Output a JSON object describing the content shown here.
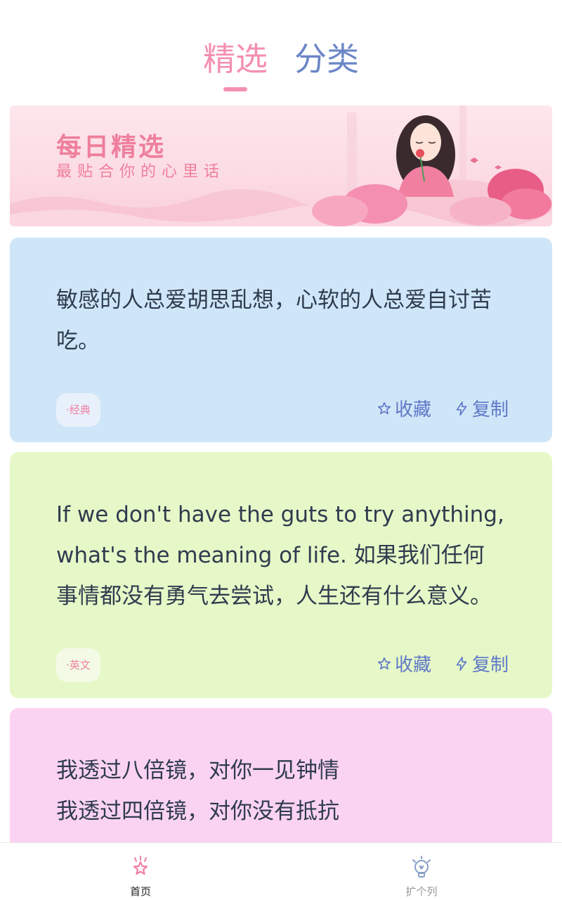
{
  "tabs": [
    {
      "label": "精选",
      "active": true
    },
    {
      "label": "分类",
      "active": false
    }
  ],
  "banner": {
    "title": "每日精选",
    "subtitle": "最贴合你的心里话"
  },
  "cards": [
    {
      "text": "敏感的人总爱胡思乱想，心软的人总爱自讨苦吃。",
      "tag": "·经典",
      "background": "#cfe6f8",
      "favorite_label": "收藏",
      "copy_label": "复制"
    },
    {
      "text": "If we don't have the guts to try anything, what's the meaning of life. 如果我们任何事情都没有勇气去尝试，人生还有什么意义。",
      "tag": "·英文",
      "background": "#e6f8c7",
      "favorite_label": "收藏",
      "copy_label": "复制"
    },
    {
      "text_lines": [
        "我透过八倍镜，对你一见钟情",
        "我透过四倍镜，对你没有抵抗"
      ],
      "background": "#fbd3f2"
    }
  ],
  "bottom_nav": [
    {
      "label": "首页",
      "icon": "star-home-icon",
      "active": true
    },
    {
      "label": "扩个列",
      "icon": "lightbulb-icon",
      "active": false
    }
  ],
  "colors": {
    "accent_pink": "#f48fb1",
    "accent_blue": "#6b86c7",
    "text_dark": "#2f3b4f"
  }
}
